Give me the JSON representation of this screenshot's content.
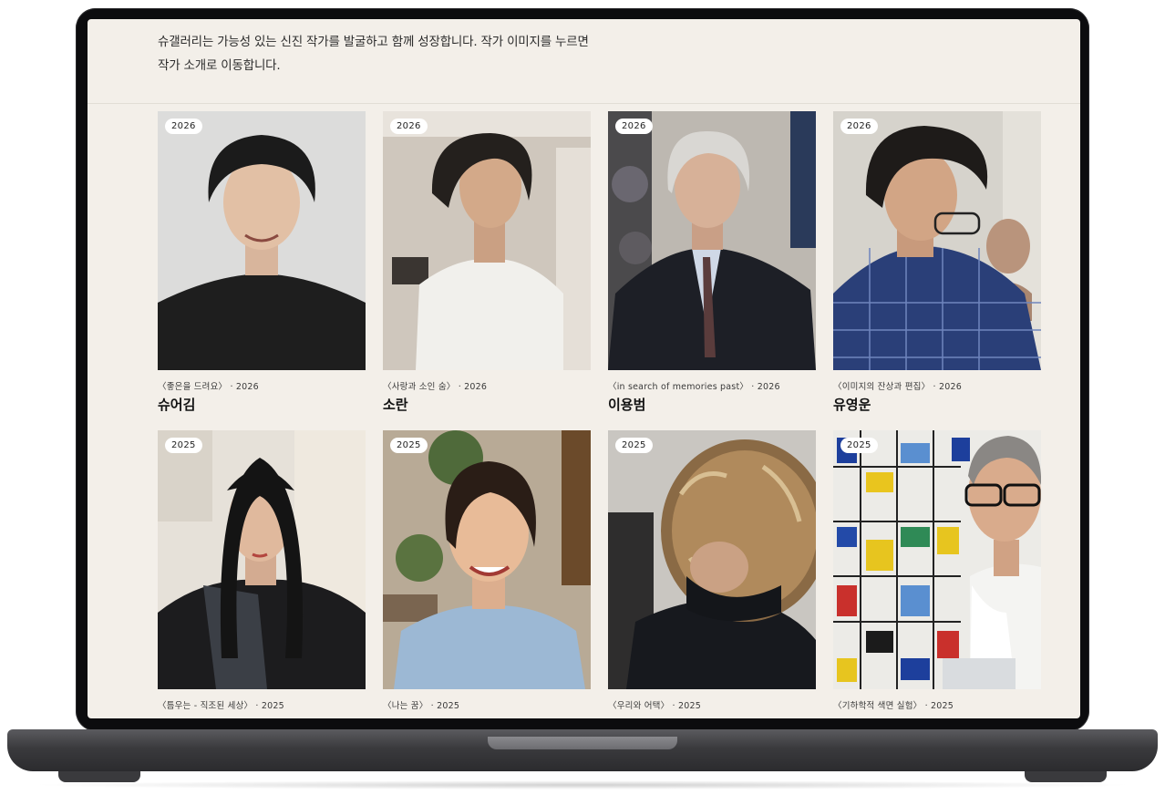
{
  "intro": {
    "line1": "슈갤러리는 가능성 있는 신진 작가를 발굴하고 함께 성장합니다. 작가 이미지를 누르면",
    "line2": "작가 소개로 이동합니다."
  },
  "artists": [
    {
      "year": "2026",
      "caption": "〈좋은을 드려요〉 · 2026",
      "name": "슈어김"
    },
    {
      "year": "2026",
      "caption": "〈사랑과 소인 숨〉 · 2026",
      "name": "소란"
    },
    {
      "year": "2026",
      "caption": "〈in search of memories past〉 · 2026",
      "name": "이용범"
    },
    {
      "year": "2026",
      "caption": "〈이미지의 잔상과 편집〉 · 2026",
      "name": "유영운"
    },
    {
      "year": "2025",
      "caption": "〈틈우는 - 직조된 세상〉 · 2025",
      "name": ""
    },
    {
      "year": "2025",
      "caption": "〈나는 꿈〉 · 2025",
      "name": ""
    },
    {
      "year": "2025",
      "caption": "〈우리와 어택〉 · 2025",
      "name": ""
    },
    {
      "year": "2025",
      "caption": "〈기하학적 색면 실험〉 · 2025",
      "name": ""
    }
  ],
  "colors": {
    "screen_bg": "#f3efe9",
    "bezel": "#0c0c0e",
    "text": "#2b2b2b"
  }
}
